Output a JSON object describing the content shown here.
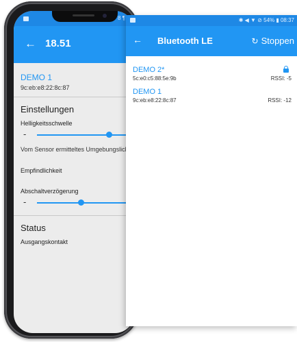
{
  "background_phone": {
    "status_text": "8 ¶",
    "toolbar": {
      "back": "←",
      "title": "18.51"
    },
    "device": {
      "name": "DEMO 1",
      "mac": "9c:eb:e8:22:8c:87"
    },
    "settings": {
      "title": "Einstellungen",
      "brightness_label": "Helligkeitsschwelle",
      "brightness_minus": "-",
      "brightness_level": 0.74,
      "sensor_note": "Vom Sensor ermitteltes Umgebungslicht",
      "sensitivity_label": "Empfindlichkeit",
      "delay_label": "Abschaltverzögerung",
      "delay_minus": "-",
      "delay_level": 0.45
    },
    "status": {
      "title": "Status",
      "output_label": "Ausgangskontakt"
    }
  },
  "bluetooth_screen": {
    "status_text": "✱ ◀ ▼ ⊘ 54% ▮ 08:37",
    "toolbar": {
      "back": "←",
      "title": "Bluetooth LE",
      "action_icon": "↻",
      "action_label": "Stoppen"
    },
    "devices": [
      {
        "name": "DEMO 2*",
        "mac": "5c:e0:c5:88:5e:9b",
        "rssi": "RSSI: -5",
        "locked": true
      },
      {
        "name": "DEMO 1",
        "mac": "9c:eb:e8:22:8c:87",
        "rssi": "RSSI: -12",
        "locked": false
      }
    ]
  },
  "colors": {
    "primary": "#2196f3",
    "status_bar": "#1e88e5"
  }
}
